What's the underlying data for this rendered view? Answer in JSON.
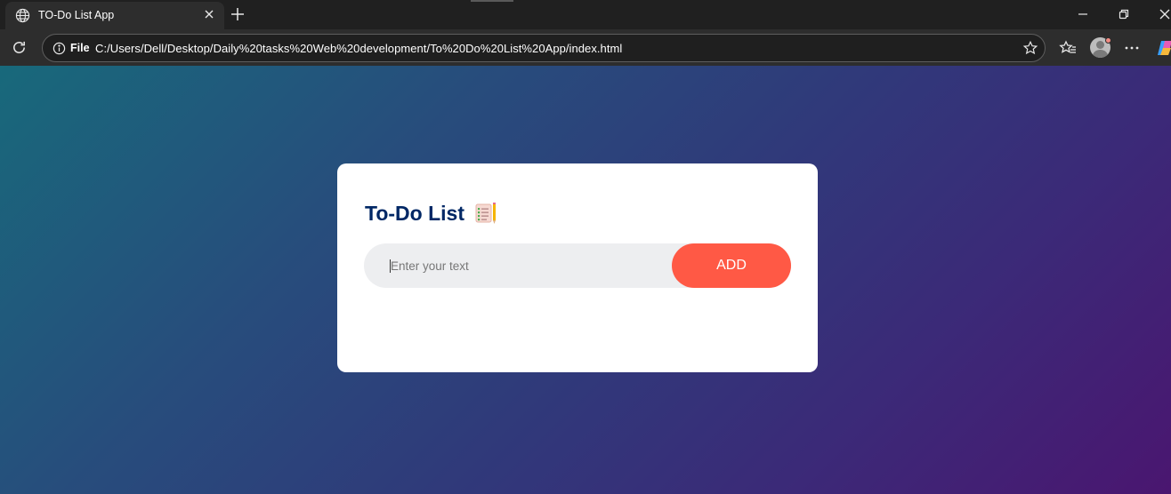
{
  "browser": {
    "tab": {
      "title": "TO-Do List App",
      "favicon": "globe-icon",
      "close_icon": "close-icon"
    },
    "new_tab_icon": "plus-icon",
    "window_controls": [
      "minimize-icon",
      "restore-icon",
      "close-icon"
    ],
    "address_bar": {
      "scheme_label": "File",
      "url": "C:/Users/Dell/Desktop/Daily%20tasks%20Web%20development/To%20Do%20List%20App/index.html",
      "icons": [
        "info-icon",
        "star-icon"
      ]
    },
    "toolbar_icons": [
      "reload-icon",
      "favorites-icon",
      "profile-avatar",
      "more-icon",
      "copilot-icon"
    ]
  },
  "app": {
    "heading": "To-Do List",
    "heading_icon": "checklist-notepad-emoji",
    "input": {
      "placeholder": "Enter your text",
      "value": ""
    },
    "add_button_label": "ADD",
    "tasks": []
  },
  "colors": {
    "gradient_start": "#18697b",
    "gradient_end": "#4a1670",
    "heading": "#002765",
    "add_button": "#ff5945",
    "input_background": "#edeef0"
  }
}
